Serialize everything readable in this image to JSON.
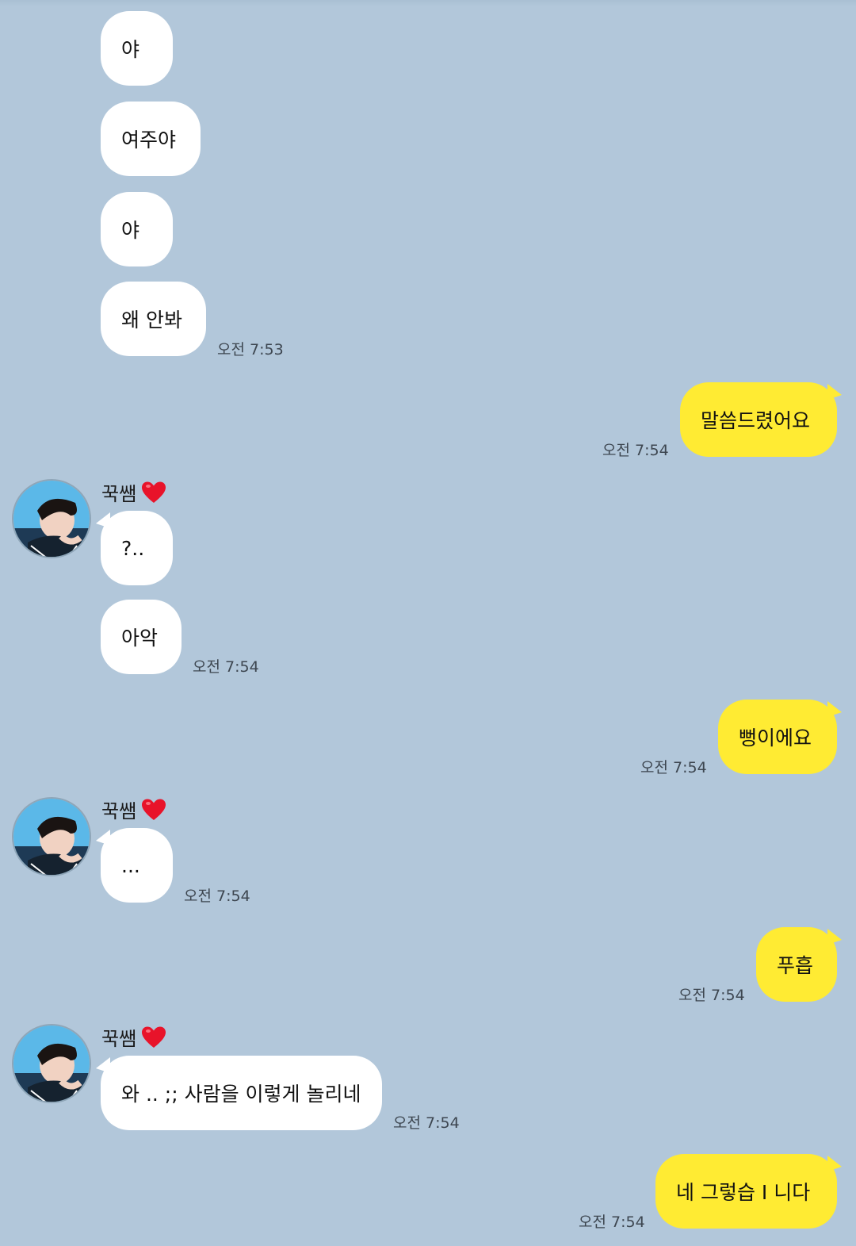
{
  "chat": {
    "messages": [
      {
        "text": "야"
      },
      {
        "text": "여주야"
      },
      {
        "text": "야"
      },
      {
        "text": "왜 안봐",
        "time": "오전 7:53"
      },
      {
        "text": "말씀드렸어요",
        "time": "오전 7:54"
      },
      {
        "sender": "꾹쌤",
        "text": "?.."
      },
      {
        "text": "아악",
        "time": "오전 7:54"
      },
      {
        "text": "뻥이에요",
        "time": "오전 7:54"
      },
      {
        "sender": "꾹쌤",
        "text": "...",
        "time": "오전 7:54"
      },
      {
        "text": "푸흡",
        "time": "오전 7:54"
      },
      {
        "sender": "꾹쌤",
        "text": "와 .. ;; 사람을 이렇게 놀리네",
        "time": "오전 7:54"
      },
      {
        "text": "네 그렇습 I 니다",
        "time": "오전 7:54"
      }
    ]
  },
  "colors": {
    "background": "#b2c7da",
    "incoming_bubble": "#ffffff",
    "outgoing_bubble": "#ffeb33",
    "heart": "#e8132a"
  },
  "icons": {
    "sender_badge": "heart-icon",
    "avatar": "profile-photo"
  }
}
